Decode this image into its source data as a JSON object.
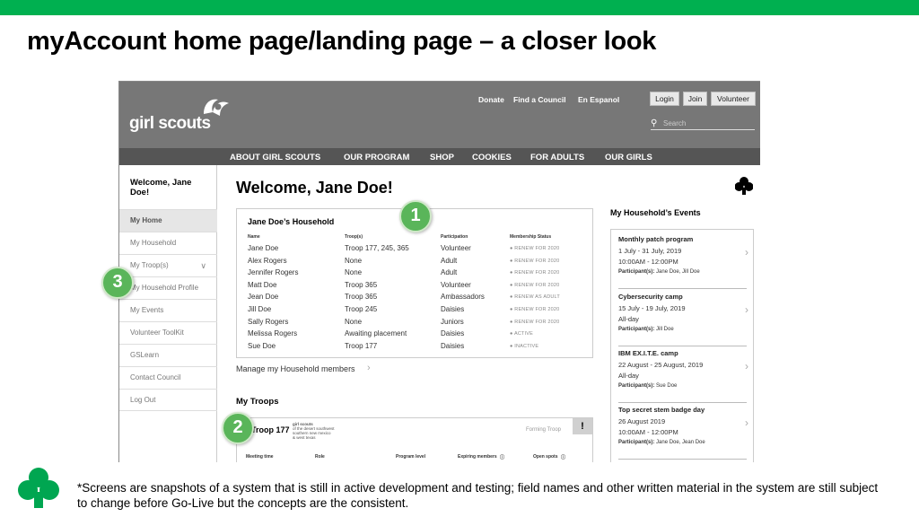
{
  "slide": {
    "title": "myAccount home page/landing page – a closer look",
    "footer_note": "*Screens are snapshots of a system that is still in active development and testing; field names and other written material in the system are still subject to change before Go-Live but the concepts are the consistent.",
    "accent_color": "#00b050"
  },
  "header": {
    "logo_text": "girl scouts",
    "links": [
      "Donate",
      "Find a Council",
      "En Espanol"
    ],
    "buttons": [
      "Login",
      "Join",
      "Volunteer"
    ],
    "search_placeholder": "Search"
  },
  "nav": {
    "items": [
      "ABOUT GIRL SCOUTS",
      "OUR PROGRAM",
      "SHOP",
      "COOKIES",
      "FOR ADULTS",
      "OUR GIRLS"
    ]
  },
  "sidebar": {
    "welcome": "Welcome, Jane Doe!",
    "items": [
      {
        "label": "My Home",
        "active": true
      },
      {
        "label": "My Household"
      },
      {
        "label": "My Troop(s)"
      },
      {
        "label": "My Household Profile"
      },
      {
        "label": "My Events"
      },
      {
        "label": "Volunteer ToolKit"
      },
      {
        "label": "GSLearn"
      },
      {
        "label": "Contact Council"
      },
      {
        "label": "Log Out"
      }
    ]
  },
  "main": {
    "title": "Welcome, Jane Doe!",
    "household": {
      "title": "Jane Doe’s Household",
      "columns": [
        "Name",
        "Troop(s)",
        "Participation",
        "Membership Status"
      ],
      "rows": [
        [
          "Jane Doe",
          "Troop 177, 245, 365",
          "Volunteer",
          "RENEW FOR 2020"
        ],
        [
          "Alex Rogers",
          "None",
          "Adult",
          "RENEW FOR 2020"
        ],
        [
          "Jennifer Rogers",
          "None",
          "Adult",
          "RENEW FOR 2020"
        ],
        [
          "Matt Doe",
          "Troop 365",
          "Volunteer",
          "RENEW FOR 2020"
        ],
        [
          "Jean Doe",
          "Troop 365",
          "Ambassadors",
          "RENEW AS ADULT"
        ],
        [
          "Jill Doe",
          "Troop 245",
          "Daisies",
          "RENEW FOR 2020"
        ],
        [
          "Sally Rogers",
          "None",
          "Juniors",
          "RENEW FOR 2020"
        ],
        [
          "Melissa Rogers",
          "Awaiting placement",
          "Daisies",
          "ACTIVE"
        ],
        [
          "Sue Doe",
          "Troop 177",
          "Daisies",
          "INACTIVE"
        ]
      ],
      "manage_link": "Manage my Household members"
    },
    "troops": {
      "title": "My Troops",
      "troop_name": "Troop 177",
      "council_lines": [
        "girl scouts",
        "of the desert southwest",
        "southern new mexico",
        "& west texas"
      ],
      "status": "Forming Troop",
      "alert": "!",
      "columns": [
        "Meeting time",
        "Role",
        "Program level",
        "Expiring members",
        "Open spots"
      ]
    }
  },
  "events": {
    "title": "My Household’s Events",
    "items": [
      {
        "name": "Monthly patch program",
        "date": "1 July - 31 July, 2019",
        "time": "10:00AM - 12:00PM",
        "participants_label": "Participant(s):",
        "participants": "Jane Doe, Jill Doe"
      },
      {
        "name": "Cybersecurity camp",
        "date": "15 July - 19 July, 2019",
        "time": "All-day",
        "participants_label": "Participant(s):",
        "participants": "Jill Doe"
      },
      {
        "name": "IBM EX.I.T.E. camp",
        "date": "22 August - 25 August, 2019",
        "time": "All-day",
        "participants_label": "Participant(s):",
        "participants": "Sue Doe"
      },
      {
        "name": "Top secret stem badge day",
        "date": "26 August 2019",
        "time": "10:00AM - 12:00PM",
        "participants_label": "Participant(s):",
        "participants": "Jane Doe, Jean Doe"
      }
    ]
  },
  "callouts": [
    "1",
    "2",
    "3"
  ]
}
